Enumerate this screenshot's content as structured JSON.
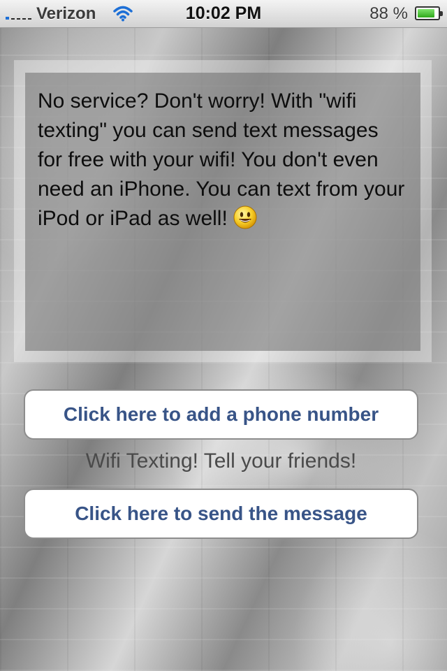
{
  "status_bar": {
    "carrier": "Verizon",
    "time": "10:02 PM",
    "battery_percent_label": "88 %",
    "battery_level": 0.88,
    "icons": [
      "signal-icon",
      "wifi-icon",
      "battery-icon"
    ]
  },
  "message_panel": {
    "text": "No service? Don't worry! With \"wifi texting\" you can send text messages for free with your wifi! You don't even need an iPhone. You can text from your iPod or iPad as well!",
    "emoji_icon": "smiley-face-icon"
  },
  "buttons": {
    "add_phone": "Click here to add a phone number",
    "send_message": "Click here to send the message"
  },
  "tagline": "Wifi Texting! Tell your friends!",
  "colors": {
    "button_text": "#385487",
    "battery_fill": "#2fa81a",
    "signal_active": "#1d6fd6"
  }
}
